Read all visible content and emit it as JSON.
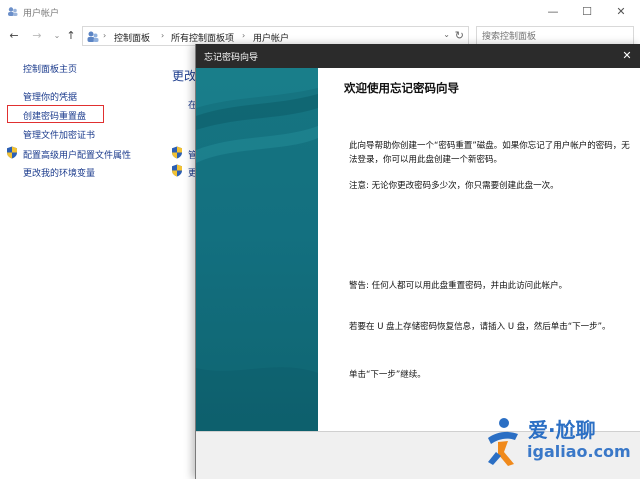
{
  "window": {
    "title": "用户帐户",
    "controls": {
      "minimize": "—",
      "maximize": "☐",
      "close": "✕"
    }
  },
  "address_bar": {
    "crumbs": [
      "控制面板",
      "所有控制面板项",
      "用户帐户"
    ],
    "search_placeholder": "搜索控制面板"
  },
  "sidebar": {
    "items": [
      {
        "label": "控制面板主页",
        "icon": ""
      },
      {
        "label": "管理你的凭据",
        "icon": ""
      },
      {
        "label": "创建密码重置盘",
        "icon": "",
        "highlighted": true
      },
      {
        "label": "管理文件加密证书",
        "icon": ""
      },
      {
        "label": "配置高级用户配置文件属性",
        "icon": "shield-icon"
      },
      {
        "label": "更改我的环境变量",
        "icon": ""
      }
    ]
  },
  "main": {
    "heading": "更改",
    "fragments": [
      "在",
      "管",
      "更"
    ]
  },
  "dialog": {
    "title": "忘记密码向导",
    "close_label": "✕",
    "welcome_title": "欢迎使用忘记密码向导",
    "paragraphs": [
      "此向导帮助你创建一个“密码重置”磁盘。如果你忘记了用户帐户的密码，无法登录，你可以用此盘创建一个新密码。",
      "注意: 无论你更改密码多少次，你只需要创建此盘一次。",
      "警告: 任何人都可以用此盘重置密码，并由此访问此帐户。",
      "若要在 U 盘上存储密码恢复信息，请插入 U 盘，然后单击“下一步”。",
      "单击“下一步”继续。"
    ]
  },
  "watermark": {
    "cn": "爱·尬聊",
    "en": "igaliao.com"
  },
  "colors": {
    "link": "#1a3a8c",
    "highlight_border": "#e03030",
    "dialog_titlebar": "#2b2b2b",
    "wizard_art": "#137080",
    "footer": "#f0f0f0"
  }
}
